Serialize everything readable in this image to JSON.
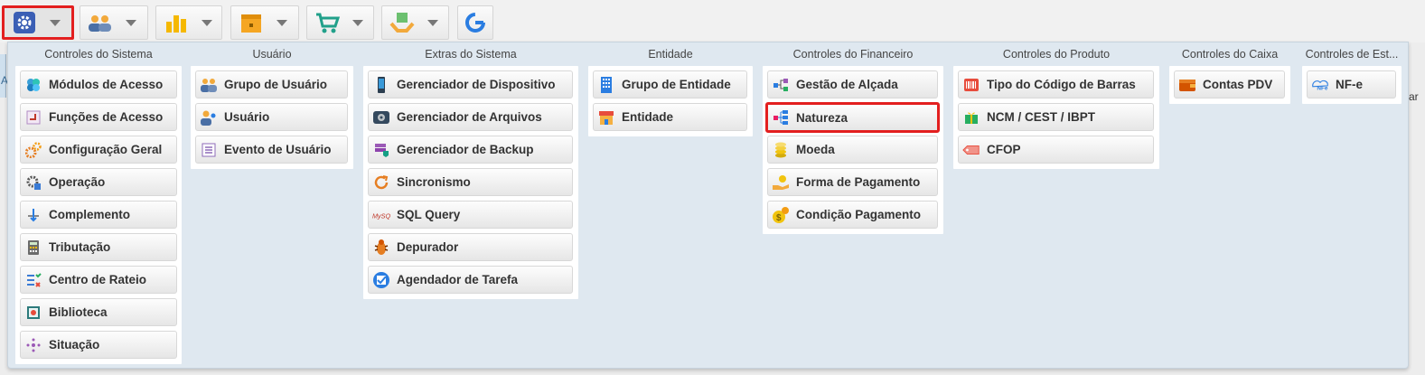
{
  "toolbar": {
    "buttons": [
      {
        "icon": "gear-icon",
        "selected": true
      },
      {
        "icon": "users-icon",
        "selected": false
      },
      {
        "icon": "bar-chart-icon",
        "selected": false
      },
      {
        "icon": "box-icon",
        "selected": false
      },
      {
        "icon": "cart-icon",
        "selected": false
      },
      {
        "icon": "hand-box-icon",
        "selected": false
      },
      {
        "icon": "refresh-g-icon",
        "selected": false
      }
    ]
  },
  "edge_text": {
    "left": "A",
    "right": "ar"
  },
  "groups": [
    {
      "title": "Controles do Sistema",
      "items": [
        {
          "label": "Módulos de Acesso",
          "icon": "modules-icon"
        },
        {
          "label": "Funções de Acesso",
          "icon": "key-function-icon"
        },
        {
          "label": "Configuração Geral",
          "icon": "gears-icon"
        },
        {
          "label": "Operação",
          "icon": "operation-gear-icon"
        },
        {
          "label": "Complemento",
          "icon": "complement-icon"
        },
        {
          "label": "Tributação",
          "icon": "calculator-icon"
        },
        {
          "label": "Centro de Rateio",
          "icon": "checklist-icon"
        },
        {
          "label": "Biblioteca",
          "icon": "library-icon"
        },
        {
          "label": "Situação",
          "icon": "situation-dots-icon"
        }
      ]
    },
    {
      "title": "Usuário",
      "items": [
        {
          "label": "Grupo de Usuário",
          "icon": "user-group-icon"
        },
        {
          "label": "Usuário",
          "icon": "user-icon"
        },
        {
          "label": "Evento de Usuário",
          "icon": "event-list-icon"
        }
      ]
    },
    {
      "title": "Extras do Sistema",
      "items": [
        {
          "label": "Gerenciador de Dispositivo",
          "icon": "device-icon"
        },
        {
          "label": "Gerenciador de Arquivos",
          "icon": "hard-drive-icon"
        },
        {
          "label": "Gerenciador de Backup",
          "icon": "backup-icon"
        },
        {
          "label": "Sincronismo",
          "icon": "sync-icon"
        },
        {
          "label": "SQL Query",
          "icon": "mysql-icon"
        },
        {
          "label": "Depurador",
          "icon": "bug-icon"
        },
        {
          "label": "Agendador de Tarefa",
          "icon": "task-check-icon"
        }
      ]
    },
    {
      "title": "Entidade",
      "items": [
        {
          "label": "Grupo de Entidade",
          "icon": "building-icon"
        },
        {
          "label": "Entidade",
          "icon": "store-icon"
        }
      ]
    },
    {
      "title": "Controles do Financeiro",
      "items": [
        {
          "label": "Gestão de Alçada",
          "icon": "flow-icon"
        },
        {
          "label": "Natureza",
          "icon": "tree-icon",
          "highlight": true
        },
        {
          "label": "Moeda",
          "icon": "coins-icon"
        },
        {
          "label": "Forma de Pagamento",
          "icon": "hand-coin-icon"
        },
        {
          "label": "Condição Pagamento",
          "icon": "money-cycle-icon"
        }
      ]
    },
    {
      "title": "Controles do Produto",
      "items": [
        {
          "label": "Tipo do Código de Barras",
          "icon": "barcode-icon"
        },
        {
          "label": "NCM / CEST / IBPT",
          "icon": "gift-money-icon"
        },
        {
          "label": "CFOP",
          "icon": "tag-icon"
        }
      ]
    },
    {
      "title": "Controles do Caixa",
      "items": [
        {
          "label": "Contas PDV",
          "icon": "wallet-icon"
        }
      ]
    },
    {
      "title": "Controles de Est...",
      "items": [
        {
          "label": "NF-e",
          "icon": "nfe-icon"
        }
      ]
    }
  ],
  "colors": {
    "highlight": "#e31f1f",
    "panel_bg": "#dfe8f0"
  }
}
